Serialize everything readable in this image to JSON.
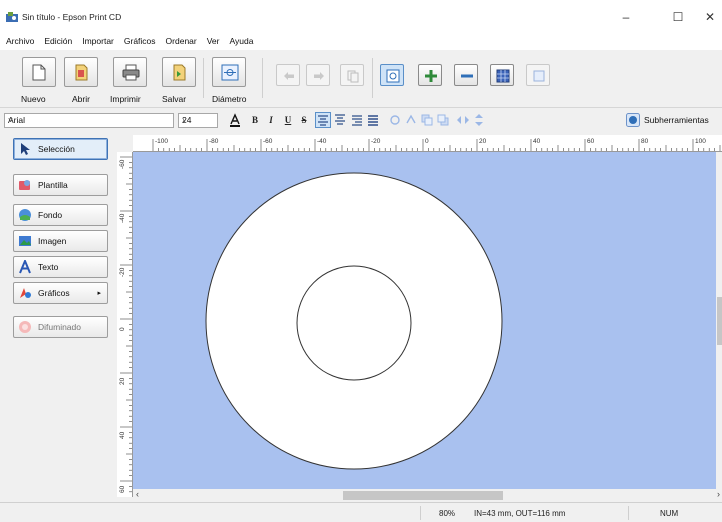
{
  "window": {
    "title": "Sin título - Epson Print CD",
    "minimize": "–",
    "maximize": "☐",
    "close": "✕"
  },
  "menu": [
    "Archivo",
    "Edición",
    "Importar",
    "Gráficos",
    "Ordenar",
    "Ver",
    "Ayuda"
  ],
  "toolbar": {
    "new_label": "Nuevo",
    "open_label": "Abrir",
    "print_label": "Imprimir",
    "save_label": "Salvar",
    "diameter_label": "Diámetro"
  },
  "format": {
    "font": "Arial",
    "size": "24",
    "bold": "B",
    "italic": "I",
    "underline": "U",
    "strike": "S",
    "subtools_label": "Subherramientas"
  },
  "left_panel": {
    "selection": "Selección",
    "template": "Plantilla",
    "background": "Fondo",
    "image": "Imagen",
    "text": "Texto",
    "graphics": "Gráficos",
    "blur": "Difuminado"
  },
  "rulers": {
    "top_labels": [
      "-100",
      "-80",
      "-60",
      "-40",
      "-20",
      "0",
      "20",
      "40",
      "60",
      "80",
      "100"
    ],
    "left_labels": [
      "-60",
      "-40",
      "-20",
      "0",
      "20",
      "40",
      "60"
    ]
  },
  "status": {
    "zoom": "80%",
    "dims": "IN=43 mm, OUT=116 mm",
    "num": "NUM"
  },
  "colors": {
    "canvas_bg": "#a9c1ef",
    "disc_fill": "#ffffff"
  },
  "icons": {
    "arrow_left": "‹",
    "arrow_right": "›",
    "combo_arrow": "˅",
    "graphics_arrow": "▸"
  }
}
